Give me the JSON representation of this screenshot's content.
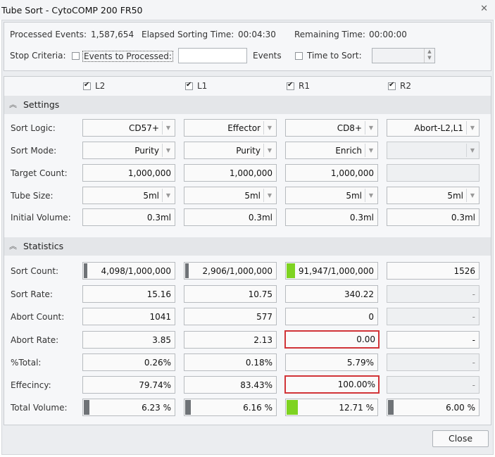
{
  "window": {
    "title": "Tube Sort - CytoCOMP 200 FR50",
    "close_icon": "close-icon"
  },
  "top": {
    "processed_events_label": "Processed Events:",
    "processed_events_value": "1,587,654",
    "elapsed_label": "Elapsed Sorting Time:",
    "elapsed_value": "00:04:30",
    "remaining_label": "Remaining Time:",
    "remaining_value": "00:00:00",
    "stop_criteria_label": "Stop Criteria:",
    "events_to_processed_label": "Events to Processed:",
    "events_to_processed_checked": false,
    "events_input_value": "",
    "events_unit": "Events",
    "time_to_sort_label": "Time to Sort:",
    "time_to_sort_checked": false,
    "time_input_value": ""
  },
  "columns": [
    {
      "label": "L2",
      "checked": true
    },
    {
      "label": "L1",
      "checked": true
    },
    {
      "label": "R1",
      "checked": true
    },
    {
      "label": "R2",
      "checked": true
    }
  ],
  "settings": {
    "title": "Settings",
    "rows": {
      "sort_logic": {
        "label": "Sort Logic:",
        "values": [
          "CD57+",
          "Effector",
          "CD8+",
          "Abort-L2,L1"
        ]
      },
      "sort_mode": {
        "label": "Sort Mode:",
        "values": [
          "Purity",
          "Purity",
          "Enrich",
          ""
        ]
      },
      "target_count": {
        "label": "Target Count:",
        "values": [
          "1,000,000",
          "1,000,000",
          "1,000,000",
          ""
        ]
      },
      "tube_size": {
        "label": "Tube Size:",
        "values": [
          "5ml",
          "5ml",
          "5ml",
          "5ml"
        ]
      },
      "initial_volume": {
        "label": "Initial Volume:",
        "values": [
          "0.3ml",
          "0.3ml",
          "0.3ml",
          "0.3ml"
        ]
      }
    }
  },
  "statistics": {
    "title": "Statistics",
    "rows": {
      "sort_count": {
        "label": "Sort Count:",
        "values": [
          "4,098/1,000,000",
          "2,906/1,000,000",
          "91,947/1,000,000",
          "1526"
        ],
        "progress": [
          0.004,
          0.003,
          0.092,
          0
        ]
      },
      "sort_rate": {
        "label": "Sort Rate:",
        "values": [
          "15.16",
          "10.75",
          "340.22",
          "-"
        ]
      },
      "abort_count": {
        "label": "Abort Count:",
        "values": [
          "1041",
          "577",
          "0",
          "-"
        ]
      },
      "abort_rate": {
        "label": "Abort Rate:",
        "values": [
          "3.85",
          "2.13",
          "0.00",
          "-"
        ]
      },
      "pct_total": {
        "label": "%Total:",
        "values": [
          "0.26%",
          "0.18%",
          "5.79%",
          "-"
        ]
      },
      "efficiency": {
        "label": "Effecincy:",
        "values": [
          "79.74%",
          "83.43%",
          "100.00%",
          "-"
        ]
      },
      "total_volume": {
        "label": "Total Volume:",
        "values": [
          "6.23 %",
          "6.16 %",
          "12.71 %",
          "6.00 %"
        ],
        "progress": [
          0.0623,
          0.0616,
          0.1271,
          0.06
        ]
      }
    }
  },
  "buttons": {
    "close_label": "Close"
  },
  "colors": {
    "progress_green": "#7ed321",
    "progress_gray": "#6f7377",
    "alert_red": "#d13438"
  }
}
